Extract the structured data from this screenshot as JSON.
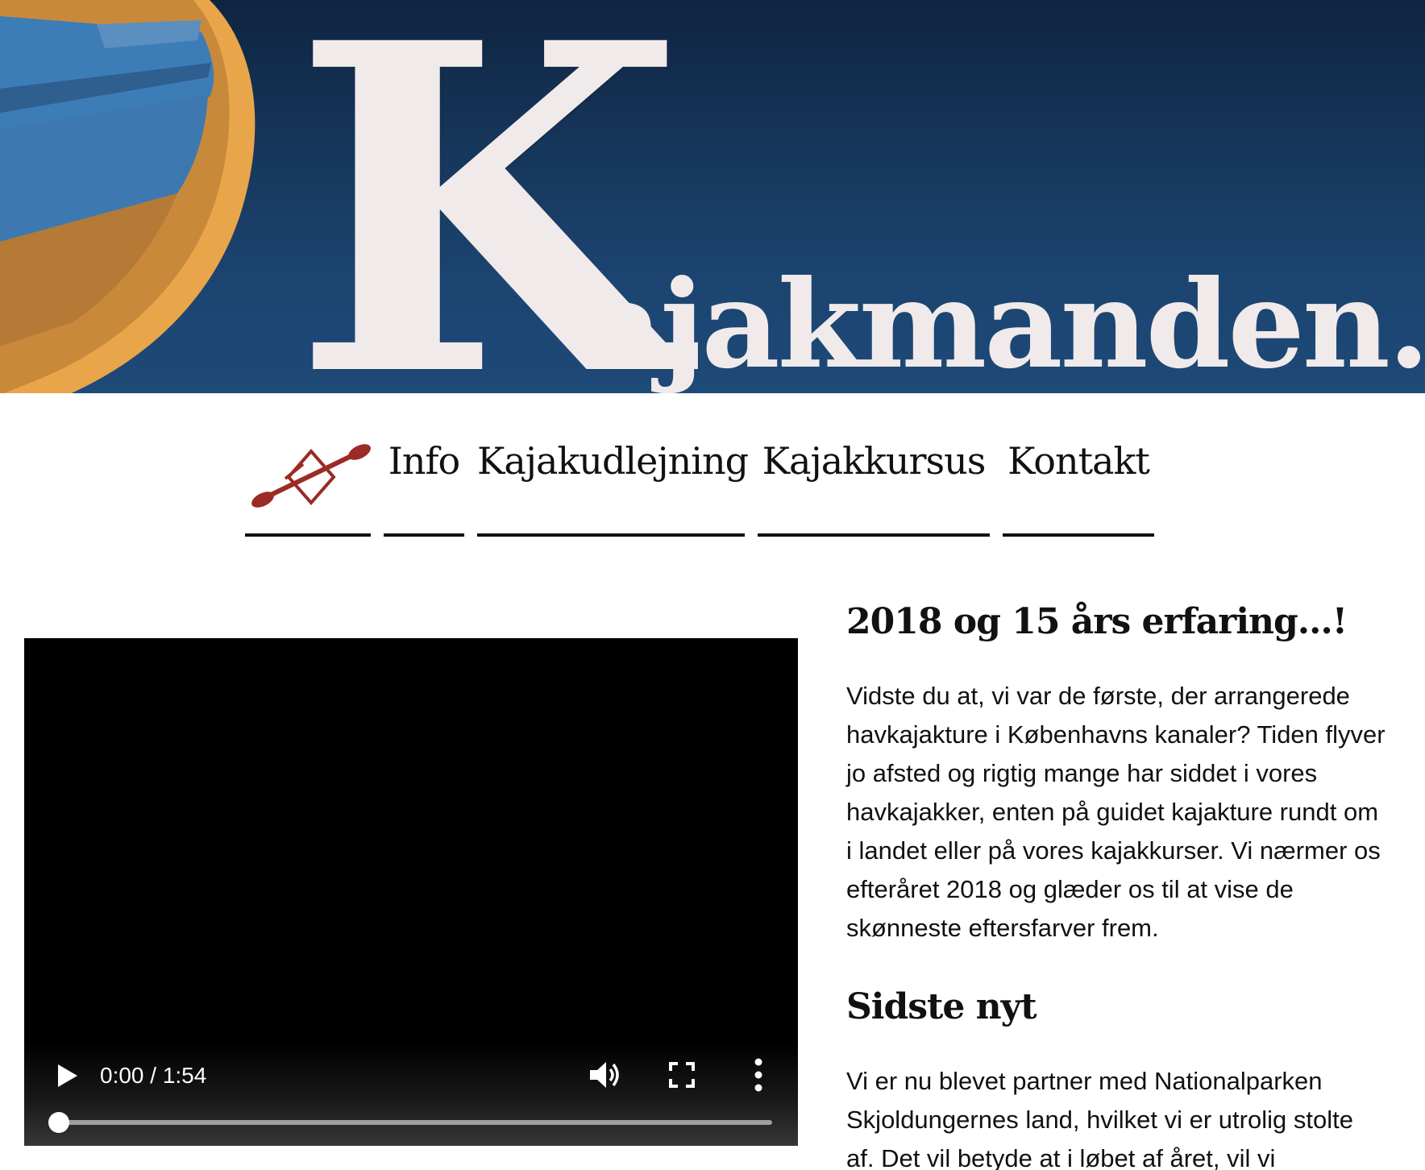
{
  "header": {
    "logo_letter": "K",
    "logo_rest": "ajakmanden.dk"
  },
  "nav": {
    "items": [
      {
        "label": "Info"
      },
      {
        "label": "Kajakudlejning"
      },
      {
        "label": "Kajakkursus"
      },
      {
        "label": "Kontakt"
      }
    ]
  },
  "video": {
    "time": "0:00 / 1:54",
    "progress": 0
  },
  "content": {
    "heading1": "2018 og 15 års erfaring…!",
    "paragraph1": "Vidste du at, vi var de første, der arrangerede havkajakture i Københavns kanaler? Tiden flyver jo afsted og rigtig mange har siddet i vores havkajakker, enten på guidet kajakture rundt om i landet eller på vores kajakkurser. Vi nærmer os efteråret 2018 og glæder os til at vise de skønneste eftersfarver frem.",
    "heading2": "Sidste nyt",
    "paragraph2": "Vi er nu blevet partner med Nationalparken Skjoldungernes land, hvilket vi er utrolig stolte af. Det vil betyde at i løbet af året, vil vi"
  },
  "colors": {
    "banner": "#1b4470",
    "logo_text": "#f1eaea",
    "paddle_icon": "#9b2b25",
    "text": "#111111"
  }
}
